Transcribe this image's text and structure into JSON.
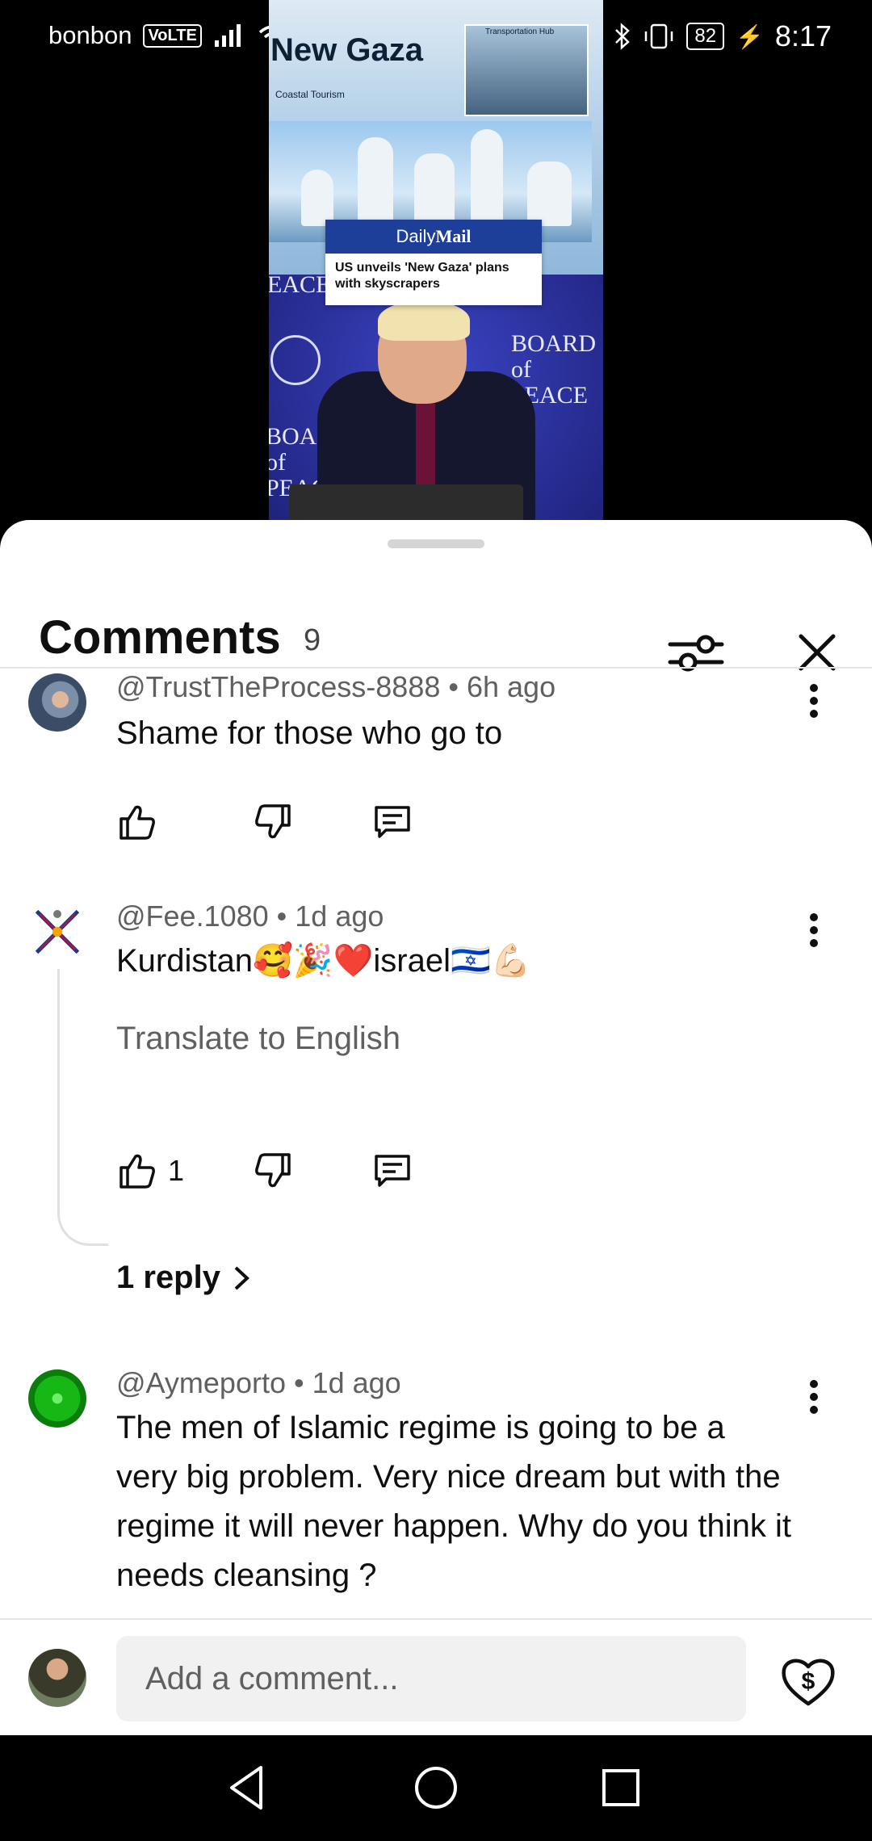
{
  "status_bar": {
    "carrier": "bonbon",
    "volte": "VoLTE",
    "battery": "82",
    "time": "8:17"
  },
  "video": {
    "title": "New Gaza",
    "label_coastal": "Coastal Tourism",
    "label_transport": "Transportation Hub",
    "card_brand_prefix": "Daily",
    "card_brand": "Mail",
    "card_headline": "US unveils 'New Gaza' plans with skyscrapers",
    "bg_text_left": "EACE",
    "bg_text_right": "BOARD of PEACE",
    "bg_text_bottom": "BOARD of PEACE"
  },
  "sheet": {
    "title": "Comments",
    "count": "9"
  },
  "comments": [
    {
      "author": "@TrustTheProcess-8888",
      "time": "6h ago",
      "text": "Shame for those who go to",
      "likes": ""
    },
    {
      "author": "@Fee.1080",
      "time": "1d ago",
      "text": "Kurdistan🥰🎉❤️israel🇮🇱💪🏻",
      "translate": "Translate to English",
      "likes": "1",
      "replies": "1 reply"
    },
    {
      "author": "@Aymeporto",
      "time": "1d ago",
      "text": "The men of Islamic regime is going to be a very big problem. Very nice dream but with the regime it will never happen.  Why do you think it needs cleansing ?",
      "likes": ""
    }
  ],
  "add_comment": {
    "placeholder": "Add a comment..."
  },
  "icons": {
    "filter": "sliders-icon",
    "close": "close-icon",
    "more": "more-vert-icon",
    "like": "thumb-up-icon",
    "dislike": "thumb-down-icon",
    "reply": "reply-bubble-icon",
    "thanks": "heart-dollar-icon",
    "nav_back": "triangle-back-icon",
    "nav_home": "circle-home-icon",
    "nav_recent": "square-recents-icon"
  }
}
